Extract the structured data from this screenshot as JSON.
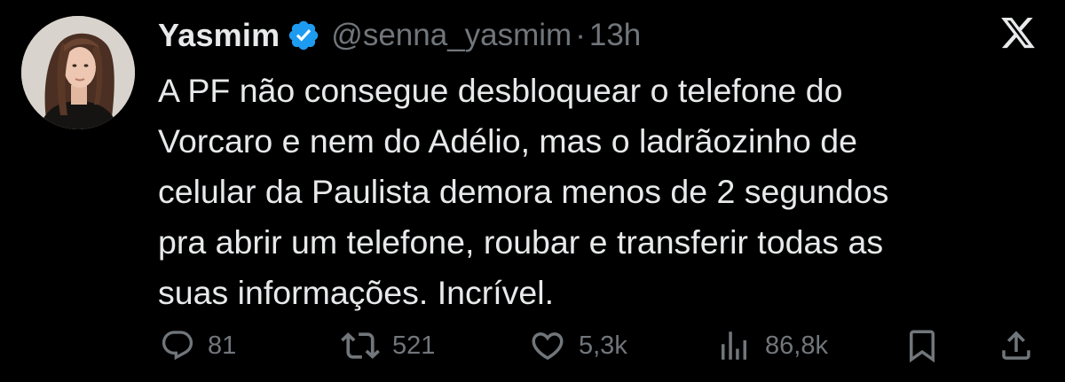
{
  "colors": {
    "background": "#000000",
    "text_primary": "#e7e9ea",
    "text_secondary": "#71767b",
    "verified_blue": "#1d9bf0"
  },
  "author": {
    "display_name": "Yasmim",
    "handle": "@senna_yasmim",
    "separator": "·",
    "time": "13h",
    "verified": true,
    "avatar_icon": "profile-photo"
  },
  "platform": {
    "logo_icon": "x-logo-icon"
  },
  "tweet": {
    "text": "A PF não consegue desbloquear o telefone do\nVorcaro e nem do Adélio, mas o ladrãozinho de\ncelular da Paulista demora menos de 2 segundos\npra abrir um telefone, roubar e transferir todas as\nsuas informações. Incrível."
  },
  "actions": {
    "replies": "81",
    "reposts": "521",
    "likes": "5,3k",
    "views": "86,8k",
    "icons": [
      "reply-icon",
      "repost-icon",
      "like-icon",
      "views-icon",
      "bookmark-icon",
      "share-icon"
    ]
  }
}
